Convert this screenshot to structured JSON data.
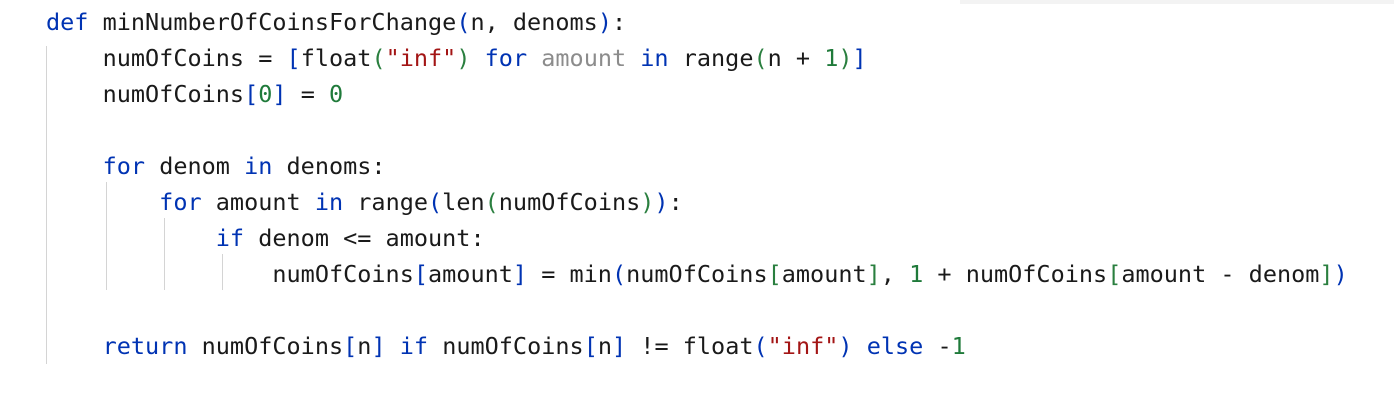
{
  "editor": {
    "lines": [
      {
        "tokens": [
          {
            "t": "def",
            "c": "kw"
          },
          {
            "t": " minNumberOfCoinsForChange",
            "c": "fn"
          },
          {
            "t": "(",
            "c": "br1"
          },
          {
            "t": "n, denoms",
            "c": "fn"
          },
          {
            "t": ")",
            "c": "br1"
          },
          {
            "t": ":",
            "c": "fn"
          }
        ]
      },
      {
        "tokens": [
          {
            "t": "    numOfCoins = ",
            "c": "fn"
          },
          {
            "t": "[",
            "c": "br1"
          },
          {
            "t": "float",
            "c": "fn"
          },
          {
            "t": "(",
            "c": "br2"
          },
          {
            "t": "\"inf\"",
            "c": "str"
          },
          {
            "t": ")",
            "c": "br2"
          },
          {
            "t": " for ",
            "c": "kw"
          },
          {
            "t": "amount",
            "c": "dim"
          },
          {
            "t": " in ",
            "c": "kw"
          },
          {
            "t": "range",
            "c": "fn"
          },
          {
            "t": "(",
            "c": "br2"
          },
          {
            "t": "n + ",
            "c": "fn"
          },
          {
            "t": "1",
            "c": "num"
          },
          {
            "t": ")",
            "c": "br2"
          },
          {
            "t": "]",
            "c": "br1"
          }
        ]
      },
      {
        "tokens": [
          {
            "t": "    numOfCoins",
            "c": "fn"
          },
          {
            "t": "[",
            "c": "br1"
          },
          {
            "t": "0",
            "c": "num"
          },
          {
            "t": "]",
            "c": "br1"
          },
          {
            "t": " = ",
            "c": "fn"
          },
          {
            "t": "0",
            "c": "num"
          }
        ]
      },
      {
        "tokens": []
      },
      {
        "tokens": [
          {
            "t": "    for",
            "c": "kw"
          },
          {
            "t": " denom ",
            "c": "fn"
          },
          {
            "t": "in",
            "c": "kw"
          },
          {
            "t": " denoms:",
            "c": "fn"
          }
        ]
      },
      {
        "tokens": [
          {
            "t": "        for",
            "c": "kw"
          },
          {
            "t": " amount ",
            "c": "fn"
          },
          {
            "t": "in",
            "c": "kw"
          },
          {
            "t": " range",
            "c": "fn"
          },
          {
            "t": "(",
            "c": "br1"
          },
          {
            "t": "len",
            "c": "fn"
          },
          {
            "t": "(",
            "c": "br2"
          },
          {
            "t": "numOfCoins",
            "c": "fn"
          },
          {
            "t": ")",
            "c": "br2"
          },
          {
            "t": ")",
            "c": "br1"
          },
          {
            "t": ":",
            "c": "fn"
          }
        ]
      },
      {
        "tokens": [
          {
            "t": "            if",
            "c": "kw"
          },
          {
            "t": " denom <= amount:",
            "c": "fn"
          }
        ]
      },
      {
        "tokens": [
          {
            "t": "                numOfCoins",
            "c": "fn"
          },
          {
            "t": "[",
            "c": "br1"
          },
          {
            "t": "amount",
            "c": "fn"
          },
          {
            "t": "]",
            "c": "br1"
          },
          {
            "t": " = min",
            "c": "fn"
          },
          {
            "t": "(",
            "c": "br1"
          },
          {
            "t": "numOfCoins",
            "c": "fn"
          },
          {
            "t": "[",
            "c": "br2"
          },
          {
            "t": "amount",
            "c": "fn"
          },
          {
            "t": "]",
            "c": "br2"
          },
          {
            "t": ", ",
            "c": "fn"
          },
          {
            "t": "1",
            "c": "num"
          },
          {
            "t": " + numOfCoins",
            "c": "fn"
          },
          {
            "t": "[",
            "c": "br2"
          },
          {
            "t": "amount - denom",
            "c": "fn"
          },
          {
            "t": "]",
            "c": "br2"
          },
          {
            "t": ")",
            "c": "br1"
          }
        ]
      },
      {
        "tokens": []
      },
      {
        "tokens": [
          {
            "t": "    return",
            "c": "kw"
          },
          {
            "t": " numOfCoins",
            "c": "fn"
          },
          {
            "t": "[",
            "c": "br1"
          },
          {
            "t": "n",
            "c": "fn"
          },
          {
            "t": "]",
            "c": "br1"
          },
          {
            "t": " if",
            "c": "kw"
          },
          {
            "t": " numOfCoins",
            "c": "fn"
          },
          {
            "t": "[",
            "c": "br1"
          },
          {
            "t": "n",
            "c": "fn"
          },
          {
            "t": "]",
            "c": "br1"
          },
          {
            "t": " != float",
            "c": "fn"
          },
          {
            "t": "(",
            "c": "br1"
          },
          {
            "t": "\"inf\"",
            "c": "str"
          },
          {
            "t": ")",
            "c": "br1"
          },
          {
            "t": " else",
            "c": "kw"
          },
          {
            "t": " -",
            "c": "fn"
          },
          {
            "t": "1",
            "c": "num"
          }
        ]
      }
    ]
  }
}
